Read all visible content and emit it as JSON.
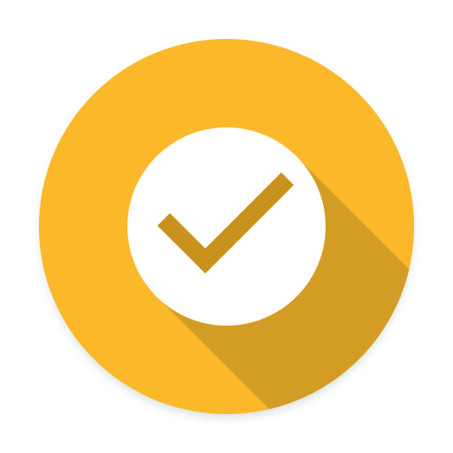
{
  "app_icon": {
    "name": "checkmark-app-icon",
    "colors": {
      "background": "#ffffff",
      "circle": "#fbb829",
      "long_shadow": "#d39d25",
      "badge": "#ffffff",
      "checkmark": "#c8921d",
      "outer_shadow": "#b9c7c2"
    },
    "icons": [
      "circle-badge-icon",
      "checkmark-icon",
      "long-shadow"
    ]
  }
}
